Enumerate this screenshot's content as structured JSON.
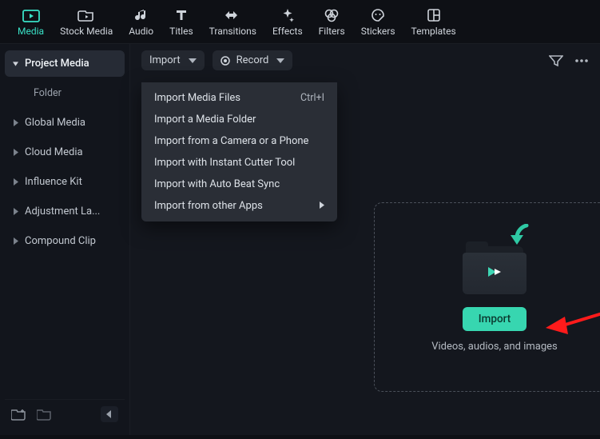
{
  "colors": {
    "accent": "#37d6b0",
    "accent_text": "#39e0c6"
  },
  "topnav": {
    "active_index": 0,
    "items": [
      {
        "label": "Media"
      },
      {
        "label": "Stock Media"
      },
      {
        "label": "Audio"
      },
      {
        "label": "Titles"
      },
      {
        "label": "Transitions"
      },
      {
        "label": "Effects"
      },
      {
        "label": "Filters"
      },
      {
        "label": "Stickers"
      },
      {
        "label": "Templates"
      }
    ]
  },
  "sidebar": {
    "items": [
      {
        "label": "Project Media",
        "active": true,
        "collapsible": true
      },
      {
        "label": "Folder",
        "sub": true
      },
      {
        "label": "Global Media",
        "collapsible": true
      },
      {
        "label": "Cloud Media",
        "collapsible": true
      },
      {
        "label": "Influence Kit",
        "collapsible": true
      },
      {
        "label": "Adjustment La...",
        "collapsible": true
      },
      {
        "label": "Compound Clip",
        "collapsible": true
      }
    ]
  },
  "toolbar": {
    "import_label": "Import",
    "record_label": "Record"
  },
  "import_menu": {
    "items": [
      {
        "label": "Import Media Files",
        "shortcut": "Ctrl+I"
      },
      {
        "label": "Import a Media Folder"
      },
      {
        "label": "Import from a Camera or a Phone"
      },
      {
        "label": "Import with Instant Cutter Tool"
      },
      {
        "label": "Import with Auto Beat Sync"
      },
      {
        "label": "Import from other Apps",
        "has_submenu": true
      }
    ]
  },
  "dropzone": {
    "button_label": "Import",
    "hint": "Videos, audios, and images"
  }
}
